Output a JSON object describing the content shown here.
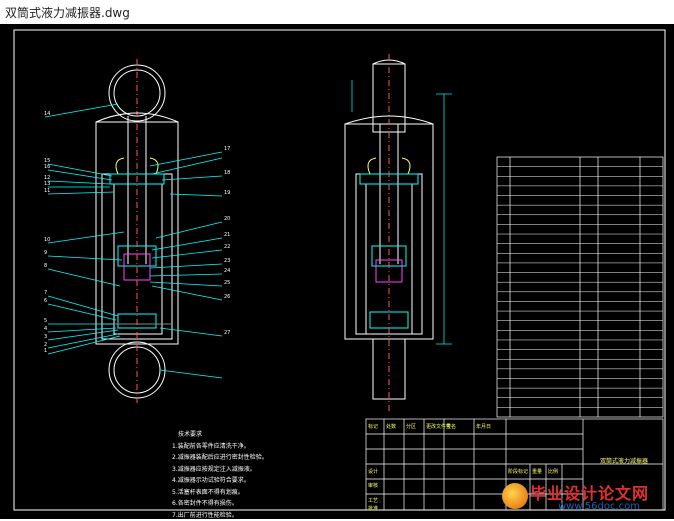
{
  "window": {
    "title": "双筒式液力减振器.dwg"
  },
  "drawing": {
    "balloon_labels_left": [
      "14",
      "15",
      "16",
      "12",
      "13",
      "11",
      "10",
      "9",
      "8",
      "7",
      "6",
      "5",
      "4",
      "3",
      "2",
      "1"
    ],
    "balloon_labels_right": [
      "17",
      "18",
      "19",
      "20",
      "21",
      "22",
      "23",
      "24",
      "25",
      "26",
      "27"
    ],
    "tech_requirements_title": "技术要求",
    "tech_requirements": [
      "1.装配前各零件应清洗干净。",
      "2.减振器装配后应进行密封性检验。",
      "3.减振器应按规定注入减振液。",
      "4.减振器示功试验符合要求。",
      "5.活塞杆表面不得有划痕。",
      "6.各密封件不得有损伤。",
      "7.出厂前进行性能检验。"
    ],
    "title_block": {
      "drawing_name": "双筒式液力减振器",
      "labels": [
        "设计",
        "审核",
        "工艺",
        "批准",
        "标记",
        "处数",
        "分区",
        "更改文件号",
        "签名",
        "年月日",
        "阶段标记",
        "重量",
        "比例"
      ]
    },
    "watermark": {
      "title": "毕业设计论文网",
      "url": "www.56doc.com"
    }
  }
}
